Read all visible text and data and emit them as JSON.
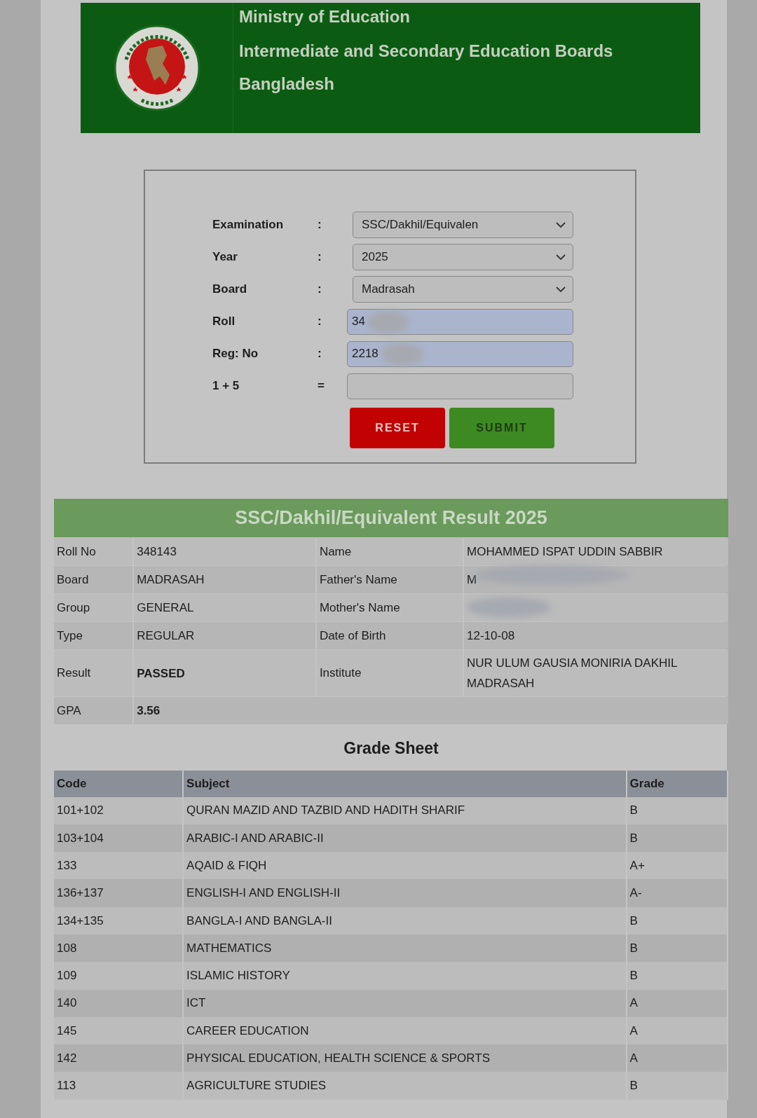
{
  "header": {
    "lines": [
      "Ministry of Education",
      "Intermediate and Secondary Education Boards",
      "Bangladesh"
    ]
  },
  "form": {
    "fields": [
      {
        "kind": "select",
        "label": "Examination",
        "separator": ":",
        "value": "SSC/Dakhil/Equivalen"
      },
      {
        "kind": "select",
        "label": "Year",
        "separator": ":",
        "value": "2025"
      },
      {
        "kind": "select",
        "label": "Board",
        "separator": ":",
        "value": "Madrasah"
      },
      {
        "kind": "input",
        "label": "Roll",
        "separator": ":",
        "value": "34",
        "redacted": true,
        "autofilled": true
      },
      {
        "kind": "input",
        "label": "Reg: No",
        "separator": ":",
        "value": "2218",
        "redacted": true,
        "autofilled": true
      },
      {
        "kind": "input",
        "label": "1 + 5",
        "separator": "=",
        "autofilled": false
      }
    ],
    "buttons": [
      {
        "kind": "reset",
        "label": "RESET"
      },
      {
        "kind": "submit",
        "label": "SUBMIT"
      }
    ]
  },
  "result": {
    "title": "SSC/Dakhil/Equivalent Result 2025",
    "rows": [
      [
        {
          "label": "Roll No",
          "value": "348143"
        },
        {
          "label": "Name",
          "value": "MOHAMMED ISPAT UDDIN SABBIR"
        }
      ],
      [
        {
          "label": "Board",
          "value": "MADRASAH"
        },
        {
          "label": "Father's Name",
          "value": "M",
          "redacted": true
        }
      ],
      [
        {
          "label": "Group",
          "value": "GENERAL"
        },
        {
          "label": "Mother's Name",
          "redacted": true
        }
      ],
      [
        {
          "label": "Type",
          "value": "REGULAR"
        },
        {
          "label": "Date of Birth",
          "value": "12-10-08"
        }
      ],
      [
        {
          "label": "Result",
          "value": "PASSED",
          "bold": true
        },
        {
          "label": "Institute",
          "value": "NUR ULUM GAUSIA MONIRIA DAKHIL MADRASAH"
        }
      ],
      [
        {
          "label": "GPA",
          "value": "3.56",
          "bold": true
        }
      ]
    ]
  },
  "grade_sheet": {
    "title": "Grade Sheet",
    "columns": [
      "Code",
      "Subject",
      "Grade"
    ],
    "rows": [
      [
        "101+102",
        "QURAN MAZID AND TAZBID AND HADITH SHARIF",
        "B"
      ],
      [
        "103+104",
        "ARABIC-I AND ARABIC-II",
        "B"
      ],
      [
        "133",
        "AQAID & FIQH",
        "A+"
      ],
      [
        "136+137",
        "ENGLISH-I AND ENGLISH-II",
        "A-"
      ],
      [
        "134+135",
        "BANGLA-I AND BANGLA-II",
        "B"
      ],
      [
        "108",
        "MATHEMATICS",
        "B"
      ],
      [
        "109",
        "ISLAMIC HISTORY",
        "B"
      ],
      [
        "140",
        "ICT",
        "A"
      ],
      [
        "145",
        "CAREER EDUCATION",
        "A"
      ],
      [
        "142",
        "PHYSICAL EDUCATION, HEALTH SCIENCE & SPORTS",
        "A"
      ],
      [
        "113",
        "AGRICULTURE STUDIES",
        "B"
      ]
    ]
  }
}
